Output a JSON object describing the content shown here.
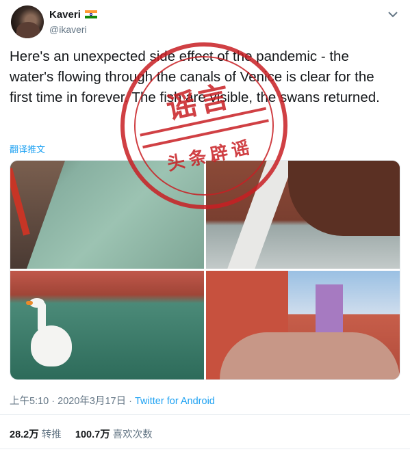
{
  "author": {
    "name": "Kaveri",
    "handle": "@ikaveri",
    "flag": "india-flag"
  },
  "tweet": {
    "text": "Here's an unexpected side effect of the pandemic - the water's flowing through the canals of Venice is clear for the first time in forever. The fish are visible, the swans returned.",
    "translate_label": "翻译推文"
  },
  "stamp": {
    "big": "谣言",
    "sub": "头条辟谣"
  },
  "meta": {
    "time": "上午5:10",
    "date": "2020年3月17日",
    "separator": "·",
    "app": "Twitter for Android"
  },
  "stats": {
    "retweets_count": "28.2万",
    "retweets_label": "转推",
    "likes_count": "100.7万",
    "likes_label": "喜欢次数"
  },
  "colors": {
    "accent": "#1da1f2",
    "text": "#14171a",
    "muted": "#657786",
    "stamp": "#c81e23"
  },
  "icons": {
    "menu": "chevron-down-icon"
  }
}
